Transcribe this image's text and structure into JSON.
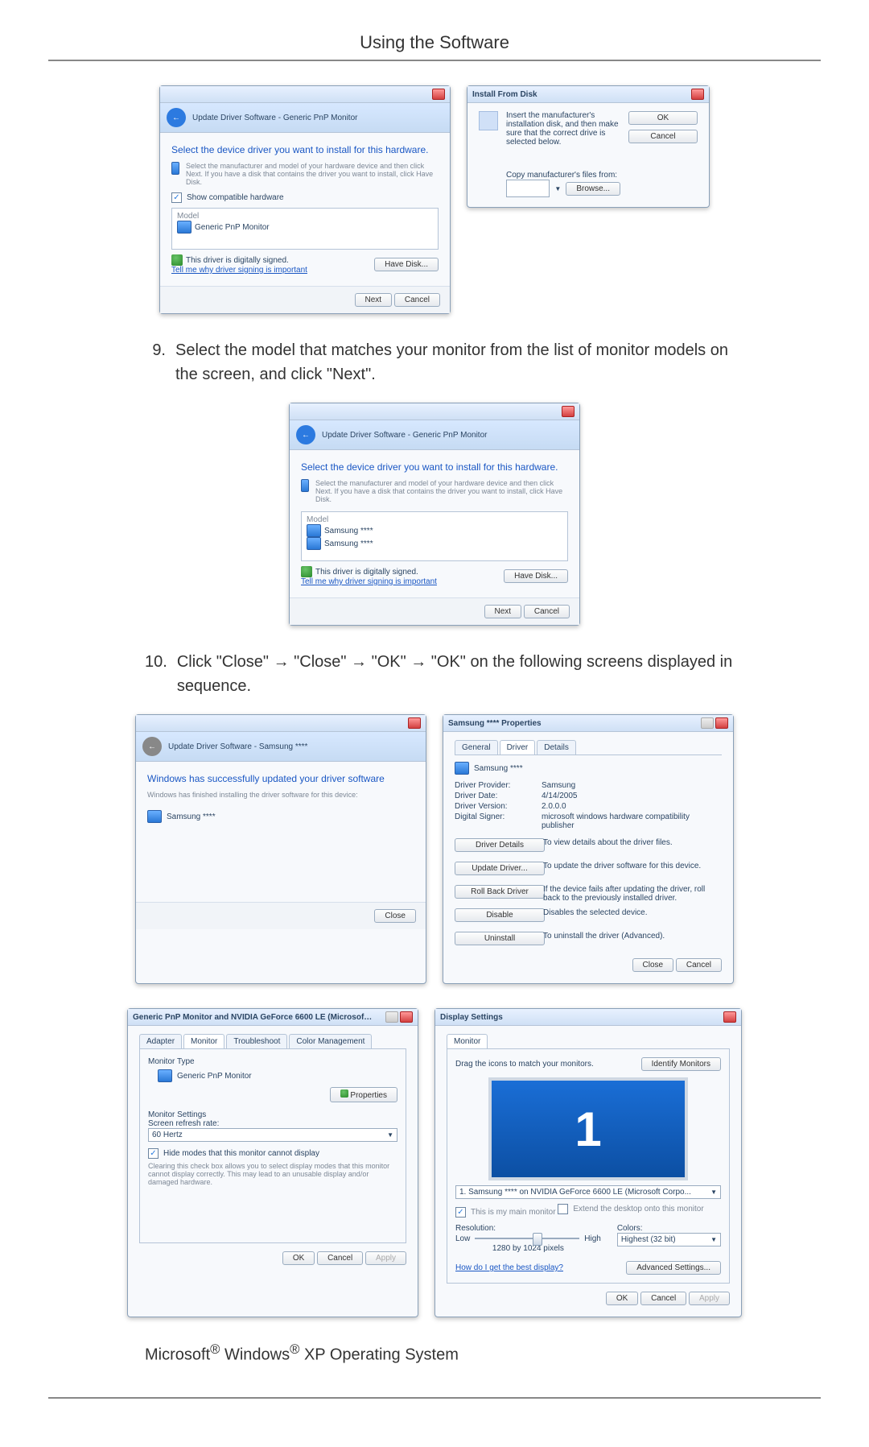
{
  "header": {
    "title": "Using the Software"
  },
  "wizard1": {
    "breadcrumb": "Update Driver Software - Generic PnP Monitor",
    "heading": "Select the device driver you want to install for this hardware.",
    "hint": "Select the manufacturer and model of your hardware device and then click Next. If you have a disk that contains the driver you want to install, click Have Disk.",
    "showCompat": "Show compatible hardware",
    "modelHeader": "Model",
    "model1": "Generic PnP Monitor",
    "signed": "This driver is digitally signed.",
    "signedLink": "Tell me why driver signing is important",
    "haveDisk": "Have Disk...",
    "next": "Next",
    "cancel": "Cancel"
  },
  "installFromDisk": {
    "title": "Install From Disk",
    "msg": "Insert the manufacturer's installation disk, and then make sure that the correct drive is selected below.",
    "ok": "OK",
    "cancel": "Cancel",
    "copyLabel": "Copy manufacturer's files from:",
    "browse": "Browse..."
  },
  "step9": {
    "num": "9.",
    "text": "Select the model that matches your monitor from the list of monitor models on the screen, and click \"Next\"."
  },
  "wizard2": {
    "breadcrumb": "Update Driver Software - Generic PnP Monitor",
    "heading": "Select the device driver you want to install for this hardware.",
    "hint": "Select the manufacturer and model of your hardware device and then click Next. If you have a disk that contains the driver you want to install, click Have Disk.",
    "modelHeader": "Model",
    "modelA": "Samsung ****",
    "modelB": "Samsung ****",
    "signed": "This driver is digitally signed.",
    "signedLink": "Tell me why driver signing is important",
    "haveDisk": "Have Disk...",
    "next": "Next",
    "cancel": "Cancel"
  },
  "step10": {
    "num": "10.",
    "text": "Click \"Close\" → \"Close\" → \"OK\" → \"OK\" on the following screens displayed in sequence."
  },
  "success": {
    "breadcrumb": "Update Driver Software - Samsung ****",
    "heading": "Windows has successfully updated your driver software",
    "sub": "Windows has finished installing the driver software for this device:",
    "dev": "Samsung ****",
    "close": "Close"
  },
  "devprops": {
    "title": "Samsung **** Properties",
    "tabs": {
      "general": "General",
      "driver": "Driver",
      "details": "Details"
    },
    "dev": "Samsung ****",
    "kv": {
      "dpL": "Driver Provider:",
      "dpV": "Samsung",
      "ddL": "Driver Date:",
      "ddV": "4/14/2005",
      "dvL": "Driver Version:",
      "dvV": "2.0.0.0",
      "dsL": "Digital Signer:",
      "dsV": "microsoft windows hardware compatibility publisher"
    },
    "btn": {
      "details": "Driver Details",
      "detailsTxt": "To view details about the driver files.",
      "update": "Update Driver...",
      "updateTxt": "To update the driver software for this device.",
      "roll": "Roll Back Driver",
      "rollTxt": "If the device fails after updating the driver, roll back to the previously installed driver.",
      "disable": "Disable",
      "disableTxt": "Disables the selected device.",
      "uninst": "Uninstall",
      "uninstTxt": "To uninstall the driver (Advanced)."
    },
    "close": "Close",
    "cancel": "Cancel"
  },
  "monprops": {
    "title": "Generic PnP Monitor and NVIDIA GeForce 6600 LE (Microsoft Co...",
    "tabs": {
      "adapter": "Adapter",
      "monitor": "Monitor",
      "trouble": "Troubleshoot",
      "color": "Color Management"
    },
    "typeLbl": "Monitor Type",
    "typeVal": "Generic PnP Monitor",
    "propBtn": "Properties",
    "settings": "Monitor Settings",
    "refreshLbl": "Screen refresh rate:",
    "refreshVal": "60 Hertz",
    "hideModes": "Hide modes that this monitor cannot display",
    "hideHelp": "Clearing this check box allows you to select display modes that this monitor cannot display correctly. This may lead to an unusable display and/or damaged hardware.",
    "ok": "OK",
    "cancel": "Cancel",
    "apply": "Apply"
  },
  "dspset": {
    "title": "Display Settings",
    "tab": "Monitor",
    "drag": "Drag the icons to match your monitors.",
    "identify": "Identify Monitors",
    "monNum": "1",
    "monSel": "1. Samsung **** on NVIDIA GeForce 6600 LE (Microsoft Corpo...",
    "main": "This is my main monitor",
    "extend": "Extend the desktop onto this monitor",
    "resLbl": "Resolution:",
    "low": "Low",
    "high": "High",
    "resVal": "1280 by 1024 pixels",
    "colLbl": "Colors:",
    "colVal": "Highest (32 bit)",
    "help": "How do I get the best display?",
    "adv": "Advanced Settings...",
    "ok": "OK",
    "cancel": "Cancel",
    "apply": "Apply"
  },
  "footer": {
    "os1": "Microsoft",
    "reg1": "®",
    "os2": " Windows",
    "reg2": "®",
    "os3": " XP Operating System"
  }
}
